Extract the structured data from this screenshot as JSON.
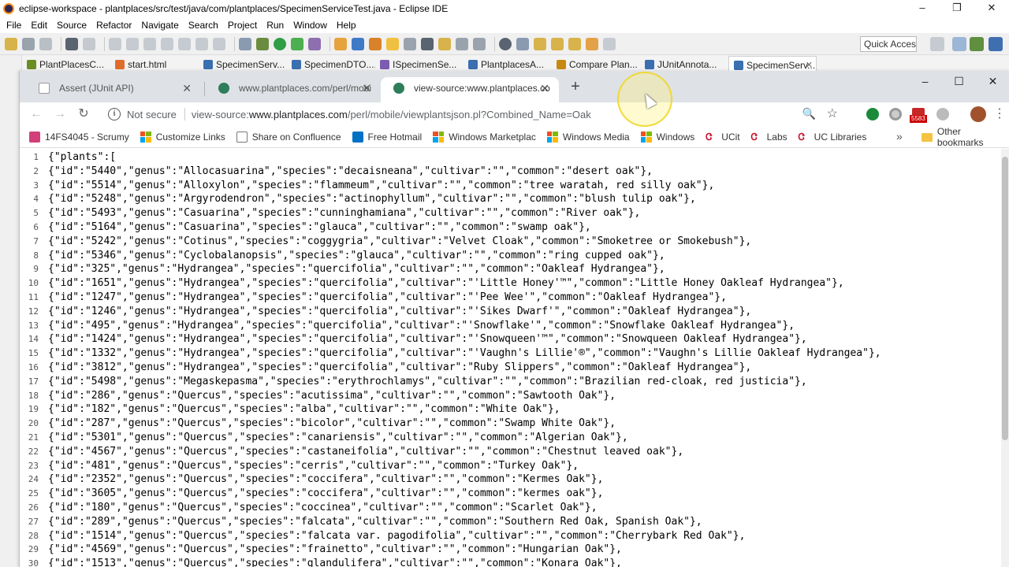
{
  "eclipse": {
    "title": "eclipse-workspace - plantplaces/src/test/java/com/plantplaces/SpecimenServiceTest.java - Eclipse IDE",
    "window_controls": [
      "–",
      "❐",
      "✕"
    ],
    "menu": [
      "File",
      "Edit",
      "Source",
      "Refactor",
      "Navigate",
      "Search",
      "Project",
      "Run",
      "Window",
      "Help"
    ],
    "quick_access": "Quick Access",
    "editor_tabs": [
      {
        "label": "PlantPlacesC...",
        "color": "#6b8e23"
      },
      {
        "label": "start.html",
        "color": "#e06c2a"
      },
      {
        "label": "SpecimenServ...",
        "color": "#3a6fb0"
      },
      {
        "label": "SpecimenDTO....",
        "color": "#3a6fb0"
      },
      {
        "label": "ISpecimenSe...",
        "color": "#7a5cb0"
      },
      {
        "label": "PlantplacesA...",
        "color": "#3a6fb0"
      },
      {
        "label": "Compare Plan...",
        "color": "#c68a12"
      },
      {
        "label": "JUnitAnnota...",
        "color": "#3a6fb0"
      },
      {
        "label": "SpecimenServ...",
        "color": "#3a6fb0"
      }
    ]
  },
  "chrome": {
    "tabs": [
      {
        "label": "Assert (JUnit API)",
        "close": "✕"
      },
      {
        "label": "www.plantplaces.com/perl/mobi",
        "close": "✕"
      },
      {
        "label": "view-source:www.plantplaces.co",
        "close": "✕"
      }
    ],
    "new_tab": "+",
    "window_controls": [
      "–",
      "☐",
      "✕"
    ],
    "nav": {
      "back": "←",
      "forward": "→",
      "reload": "↻"
    },
    "info_icon": "i",
    "not_secure": "Not secure",
    "url_prefix": "view-source:",
    "url_host": "www.plantplaces.com",
    "url_path": "/perl/mobile/viewplantsjson.pl?Combined_Name=Oak",
    "zoom_icon": "🔍",
    "star_icon": "☆",
    "ext_badge": "5583",
    "bookmarks": [
      {
        "label": "14FS4045 - Scrumy",
        "icon": "scrumy"
      },
      {
        "label": "Customize Links",
        "icon": "ms"
      },
      {
        "label": "Share on Confluence",
        "icon": "page"
      },
      {
        "label": "Free Hotmail",
        "icon": "outlook"
      },
      {
        "label": "Windows Marketplac",
        "icon": "ms"
      },
      {
        "label": "Windows Media",
        "icon": "ms"
      },
      {
        "label": "Windows",
        "icon": "ms"
      },
      {
        "label": "UCit",
        "icon": "uc"
      },
      {
        "label": "Labs",
        "icon": "uc"
      },
      {
        "label": "UC Libraries",
        "icon": "uc"
      }
    ],
    "bookmarks_more": "»",
    "other_bookmarks": "Other bookmarks"
  },
  "source_lines": [
    "{\"plants\":[",
    "{\"id\":\"5440\",\"genus\":\"Allocasuarina\",\"species\":\"decaisneana\",\"cultivar\":\"\",\"common\":\"desert oak\"},",
    "{\"id\":\"5514\",\"genus\":\"Alloxylon\",\"species\":\"flammeum\",\"cultivar\":\"\",\"common\":\"tree waratah, red silly oak\"},",
    "{\"id\":\"5248\",\"genus\":\"Argyrodendron\",\"species\":\"actinophyllum\",\"cultivar\":\"\",\"common\":\"blush tulip oak\"},",
    "{\"id\":\"5493\",\"genus\":\"Casuarina\",\"species\":\"cunninghamiana\",\"cultivar\":\"\",\"common\":\"River oak\"},",
    "{\"id\":\"5164\",\"genus\":\"Casuarina\",\"species\":\"glauca\",\"cultivar\":\"\",\"common\":\"swamp oak\"},",
    "{\"id\":\"5242\",\"genus\":\"Cotinus\",\"species\":\"coggygria\",\"cultivar\":\"Velvet Cloak\",\"common\":\"Smoketree or Smokebush\"},",
    "{\"id\":\"5346\",\"genus\":\"Cyclobalanopsis\",\"species\":\"glauca\",\"cultivar\":\"\",\"common\":\"ring cupped oak\"},",
    "{\"id\":\"325\",\"genus\":\"Hydrangea\",\"species\":\"quercifolia\",\"cultivar\":\"\",\"common\":\"Oakleaf Hydrangea\"},",
    "{\"id\":\"1651\",\"genus\":\"Hydrangea\",\"species\":\"quercifolia\",\"cultivar\":\"'Little Honey'™\",\"common\":\"Little Honey Oakleaf Hydrangea\"},",
    "{\"id\":\"1247\",\"genus\":\"Hydrangea\",\"species\":\"quercifolia\",\"cultivar\":\"'Pee Wee'\",\"common\":\"Oakleaf Hydrangea\"},",
    "{\"id\":\"1246\",\"genus\":\"Hydrangea\",\"species\":\"quercifolia\",\"cultivar\":\"'Sikes Dwarf'\",\"common\":\"Oakleaf Hydrangea\"},",
    "{\"id\":\"495\",\"genus\":\"Hydrangea\",\"species\":\"quercifolia\",\"cultivar\":\"'Snowflake'\",\"common\":\"Snowflake Oakleaf Hydrangea\"},",
    "{\"id\":\"1424\",\"genus\":\"Hydrangea\",\"species\":\"quercifolia\",\"cultivar\":\"'Snowqueen'™\",\"common\":\"Snowqueen Oakleaf Hydrangea\"},",
    "{\"id\":\"1332\",\"genus\":\"Hydrangea\",\"species\":\"quercifolia\",\"cultivar\":\"'Vaughn's Lillie'®\",\"common\":\"Vaughn's Lillie Oakleaf Hydrangea\"},",
    "{\"id\":\"3812\",\"genus\":\"Hydrangea\",\"species\":\"quercifolia\",\"cultivar\":\"Ruby Slippers\",\"common\":\"Oakleaf Hydrangea\"},",
    "{\"id\":\"5498\",\"genus\":\"Megaskepasma\",\"species\":\"erythrochlamys\",\"cultivar\":\"\",\"common\":\"Brazilian red-cloak, red justicia\"},",
    "{\"id\":\"286\",\"genus\":\"Quercus\",\"species\":\"acutissima\",\"cultivar\":\"\",\"common\":\"Sawtooth Oak\"},",
    "{\"id\":\"182\",\"genus\":\"Quercus\",\"species\":\"alba\",\"cultivar\":\"\",\"common\":\"White Oak\"},",
    "{\"id\":\"287\",\"genus\":\"Quercus\",\"species\":\"bicolor\",\"cultivar\":\"\",\"common\":\"Swamp White Oak\"},",
    "{\"id\":\"5301\",\"genus\":\"Quercus\",\"species\":\"canariensis\",\"cultivar\":\"\",\"common\":\"Algerian Oak\"},",
    "{\"id\":\"4567\",\"genus\":\"Quercus\",\"species\":\"castaneifolia\",\"cultivar\":\"\",\"common\":\"Chestnut leaved oak\"},",
    "{\"id\":\"481\",\"genus\":\"Quercus\",\"species\":\"cerris\",\"cultivar\":\"\",\"common\":\"Turkey Oak\"},",
    "{\"id\":\"2352\",\"genus\":\"Quercus\",\"species\":\"coccifera\",\"cultivar\":\"\",\"common\":\"Kermes Oak\"},",
    "{\"id\":\"3605\",\"genus\":\"Quercus\",\"species\":\"coccifera\",\"cultivar\":\"\",\"common\":\"kermes oak\"},",
    "{\"id\":\"180\",\"genus\":\"Quercus\",\"species\":\"coccinea\",\"cultivar\":\"\",\"common\":\"Scarlet Oak\"},",
    "{\"id\":\"289\",\"genus\":\"Quercus\",\"species\":\"falcata\",\"cultivar\":\"\",\"common\":\"Southern Red Oak, Spanish Oak\"},",
    "{\"id\":\"1514\",\"genus\":\"Quercus\",\"species\":\"falcata var. pagodifolia\",\"cultivar\":\"\",\"common\":\"Cherrybark Red Oak\"},",
    "{\"id\":\"4569\",\"genus\":\"Quercus\",\"species\":\"frainetto\",\"cultivar\":\"\",\"common\":\"Hungarian Oak\"},",
    "{\"id\":\"1513\",\"genus\":\"Quercus\",\"species\":\"glandulifera\",\"cultivar\":\"\",\"common\":\"Konara Oak\"},"
  ]
}
